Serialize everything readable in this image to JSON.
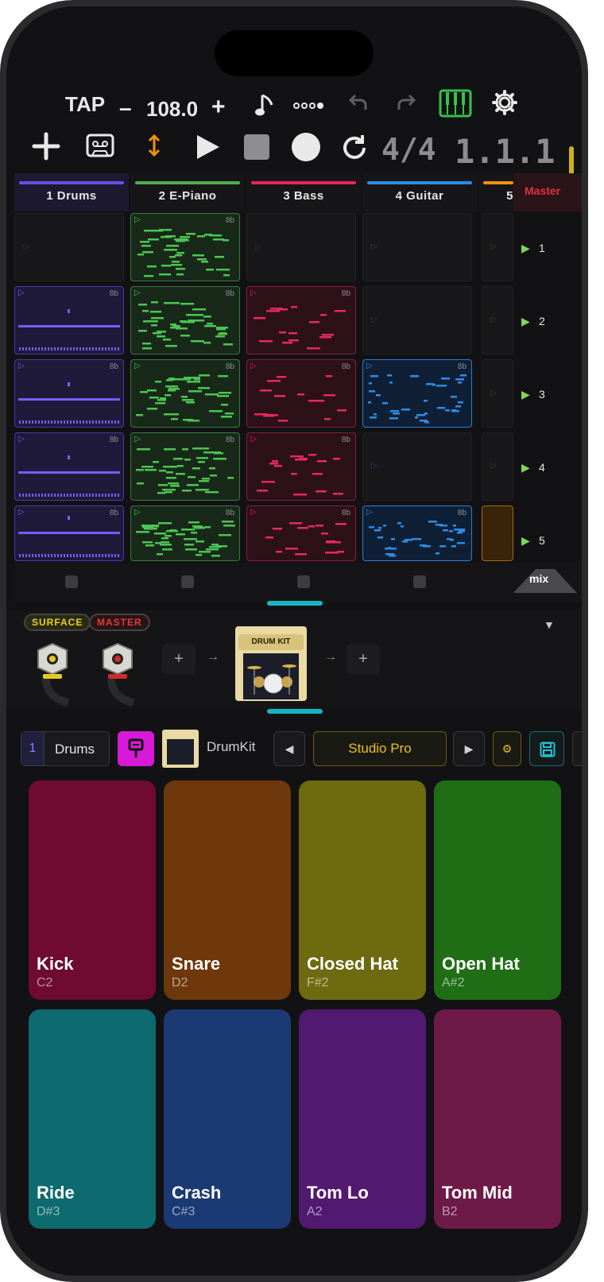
{
  "toolbar": {
    "tap_label": "TAP",
    "tempo_minus": "–",
    "tempo": "108.0",
    "tempo_plus": "+",
    "time_signature": "4/4",
    "position": "1.1.1"
  },
  "tracks": [
    {
      "label": "1  Drums",
      "color": "#6c4de6"
    },
    {
      "label": "2  E-Piano",
      "color": "#4caf50"
    },
    {
      "label": "3  Bass",
      "color": "#e6245a"
    },
    {
      "label": "4  Guitar",
      "color": "#2f8be6"
    },
    {
      "label": "5",
      "color": "#f0920f"
    }
  ],
  "master_label": "Master",
  "scenes": [
    "1",
    "2",
    "3",
    "4",
    "5"
  ],
  "clip_length_label": "8b",
  "mix_label": "mix",
  "chain": {
    "surface_label": "SURFACE",
    "master_label": "MASTER",
    "plugin_label": "DRUM KIT",
    "add_label": "+",
    "arrow": "→",
    "collapse_icon": "▼"
  },
  "instrument_bar": {
    "track_number": "1",
    "track_name": "Drums",
    "instrument_name": "DrumKit",
    "preset_name": "Studio Pro",
    "prev": "◀",
    "next": "▶",
    "gear": "⚙"
  },
  "pads": [
    {
      "name": "Kick",
      "note": "C2",
      "color": "#6e0b2f"
    },
    {
      "name": "Snare",
      "note": "D2",
      "color": "#6e370c"
    },
    {
      "name": "Closed Hat",
      "note": "F#2",
      "color": "#6e6a0f"
    },
    {
      "name": "Open Hat",
      "note": "A#2",
      "color": "#1f6e16"
    },
    {
      "name": "Ride",
      "note": "D#3",
      "color": "#0d6a6e"
    },
    {
      "name": "Crash",
      "note": "C#3",
      "color": "#1b3a74"
    },
    {
      "name": "Tom Lo",
      "note": "A2",
      "color": "#521970"
    },
    {
      "name": "Tom Mid",
      "note": "B2",
      "color": "#6e1a48"
    }
  ]
}
